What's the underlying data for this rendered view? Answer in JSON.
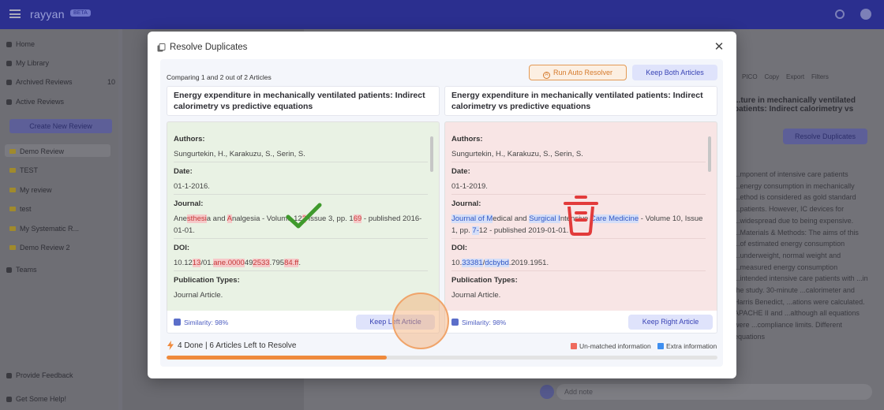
{
  "app": {
    "logo": "rayyan",
    "badge": "BETA",
    "sidebar": {
      "home": "Home",
      "library": "My Library",
      "archived": "Archived Reviews",
      "archived_count": "10",
      "active": "Active Reviews",
      "create": "Create New Review",
      "reviews": [
        "Demo Review",
        "TEST",
        "My review",
        "test",
        "My Systematic R...",
        "Demo Review 2"
      ],
      "teams": "Teams",
      "feedback": "Provide Feedback",
      "help": "Get Some Help!"
    },
    "right_panel": {
      "tools": [
        "PICO",
        "Copy",
        "Export",
        "Filters"
      ],
      "title": "...ture in mechanically ventilated patients: Indirect calorimetry vs",
      "resolve_button": "Resolve Duplicates",
      "abstract": "...mponent of intensive care patients ...energy consumption in mechanically ...ethod is considered as gold standard ...patients. However, IC devices for ...widespread due to being expensive. ...Materials & Methods: The aims of this ...of estimated energy consumption ...underweight, normal weight and ...measured energy consumption ...intended intensive care patients with ...in the study. 30-minute ...calorimeter and Harris Benedict, ...ations were calculated. APACHE II and ...although all equations were ...compliance limits. Different equations"
    },
    "note_placeholder": "Add note"
  },
  "modal": {
    "title": "Resolve Duplicates",
    "close_icon": "close-icon",
    "comparing": "Comparing 1 and 2 out of 2 Articles",
    "auto_resolver": "Run Auto Resolver",
    "keep_both": "Keep Both Articles",
    "left": {
      "title": "Energy expenditure in mechanically ventilated patients: Indirect calorimetry vs predictive equations",
      "authors_label": "Authors:",
      "authors": "Sungurtekin, H., Karakuzu, S., Serin, S.",
      "date_label": "Date:",
      "date": "01-1-2016.",
      "journal_label": "Journal:",
      "journal_parts": [
        "Ane",
        "sthesi",
        "a and ",
        "A",
        "nalgesia - Volume 12",
        "2",
        " Issue 3, pp. 1",
        "69",
        " - published 2016-01-01."
      ],
      "doi_label": "DOI:",
      "doi_parts": [
        "10.12",
        "13",
        "/01.",
        "ane.0000",
        "49",
        "2533",
        ".795",
        "84.ff",
        "."
      ],
      "pubtypes_label": "Publication Types:",
      "pubtypes": "Journal Article.",
      "similarity": "Similarity: 98%",
      "keep": "Keep Left Article"
    },
    "right": {
      "title": "Energy expenditure in mechanically ventilated patients: Indirect calorimetry vs predictive equations",
      "authors_label": "Authors:",
      "authors": "Sungurtekin, H., Karakuzu, S., Serin, S.",
      "date_label": "Date:",
      "date": "01-1-2019.",
      "journal_label": "Journal:",
      "journal_parts": [
        "Journal of M",
        "edical and ",
        "Surgical I",
        "ntensive ",
        "Care Medicine",
        " - Volume 10, Issue 1, pp. ",
        "7-",
        "12 - published 2019-01-01."
      ],
      "doi_label": "DOI:",
      "doi_parts": [
        "10.",
        "33381",
        "/",
        "dcbybd",
        ".2019.1951."
      ],
      "pubtypes_label": "Publication Types:",
      "pubtypes": "Journal Article.",
      "similarity": "Similarity: 98%",
      "keep": "Keep Right Article"
    },
    "progress": {
      "text": "4 Done | 6 Articles Left to Resolve",
      "fraction": 0.4,
      "legend_unmatched": "Un-matched information",
      "legend_extra": "Extra information"
    },
    "colors": {
      "unmatched": "#ef6b5e",
      "extra": "#3f8ff0",
      "progress": "#ef8a3c",
      "keep_left": "#e9f2e4",
      "discard_right": "#f8e5e5"
    }
  }
}
